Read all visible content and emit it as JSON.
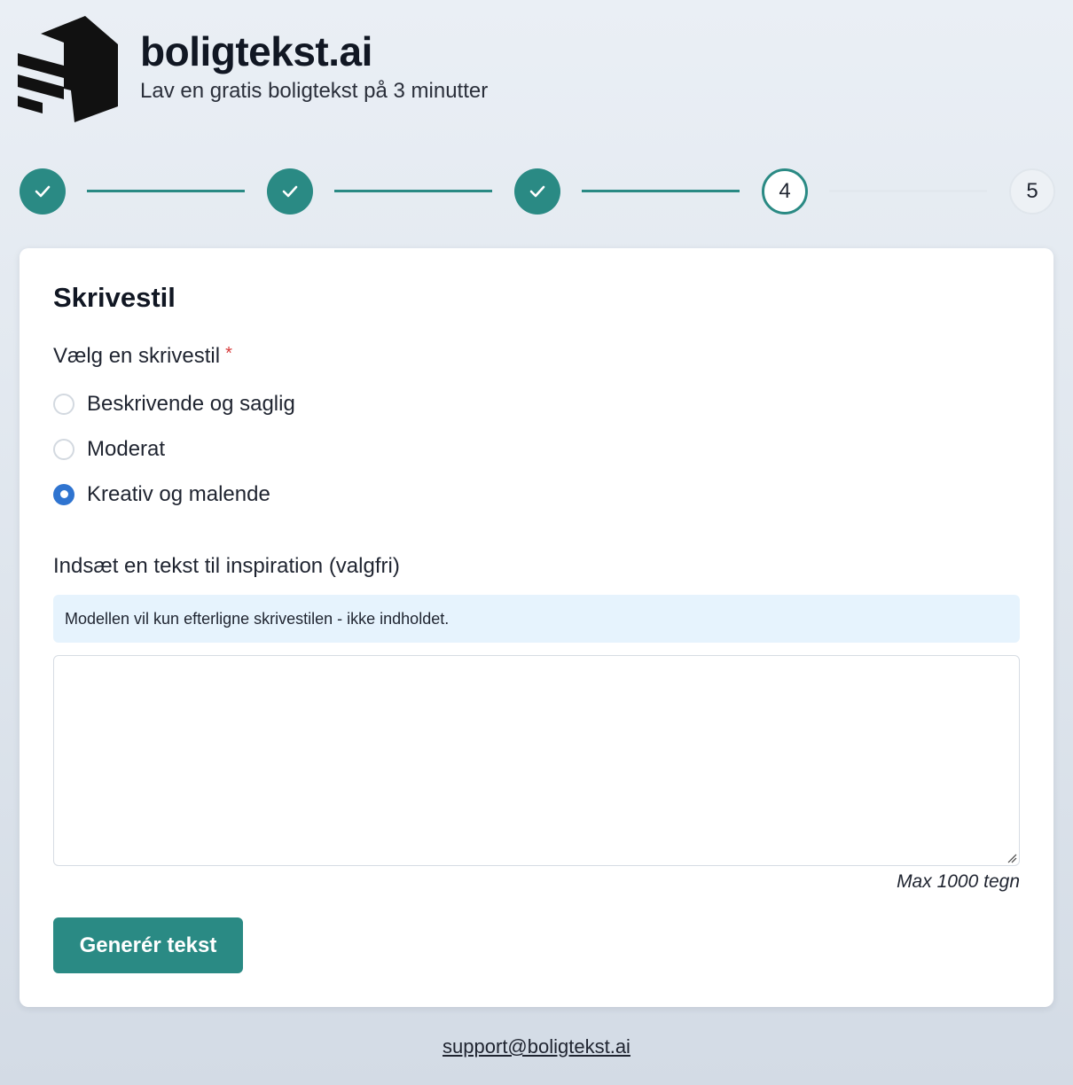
{
  "brand": {
    "name": "boligtekst.ai",
    "tagline": "Lav en gratis boligtekst på 3 minutter",
    "logo_icon": "house-stripes-logo-icon"
  },
  "stepper": {
    "steps": [
      {
        "state": "done",
        "icon": "check-icon"
      },
      {
        "state": "done",
        "icon": "check-icon"
      },
      {
        "state": "done",
        "icon": "check-icon"
      },
      {
        "state": "active",
        "label": "4"
      },
      {
        "state": "todo",
        "label": "5"
      }
    ],
    "current_step": 4,
    "total_steps": 5
  },
  "form": {
    "title": "Skrivestil",
    "style_label": "Vælg en skrivestil",
    "required_mark": "*",
    "options": [
      {
        "label": "Beskrivende og saglig",
        "checked": false
      },
      {
        "label": "Moderat",
        "checked": false
      },
      {
        "label": "Kreativ og malende",
        "checked": true
      }
    ],
    "inspiration_label": "Indsæt en tekst til inspiration (valgfri)",
    "info_text": "Modellen vil kun efterligne skrivestilen - ikke indholdet.",
    "textarea_value": "",
    "char_hint": "Max 1000 tegn",
    "submit_label": "Generér tekst"
  },
  "footer": {
    "support_email": "support@boligtekst.ai"
  },
  "colors": {
    "accent": "#2a8a84",
    "radio_selected": "#2f74d0",
    "info_bg": "#e6f3fd",
    "required": "#d73b3b"
  }
}
